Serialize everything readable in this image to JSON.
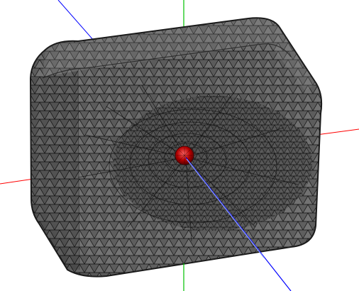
{
  "viewport": {
    "background": "#ffffff"
  },
  "colors": {
    "x_axis": "#ff0000",
    "y_axis": "#00c000",
    "z_axis": "#0000ff",
    "mesh_fill": "#6a6a6a",
    "mesh_lines": "#111111",
    "marker": "#b00000"
  },
  "icons": {
    "axes": "xyz-axes-icon",
    "mesh": "triangulated-box-mesh",
    "marker": "red-sphere-marker"
  }
}
